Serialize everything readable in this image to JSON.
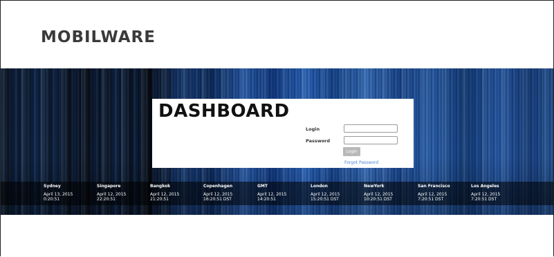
{
  "brand": {
    "logo_text": "MOBILWARE"
  },
  "dashboard": {
    "title": "DASHBOARD"
  },
  "login_form": {
    "login_label": "Login",
    "password_label": "Password",
    "login_value": "",
    "password_value": "",
    "submit_label": "Login",
    "forgot_link": "Forgot Password"
  },
  "clocks": [
    {
      "city": "Sydney",
      "date": "April 13, 2015",
      "time": "0:20:51"
    },
    {
      "city": "Singapore",
      "date": "April 12, 2015",
      "time": "22:20:51"
    },
    {
      "city": "Bangkok",
      "date": "April 12, 2015",
      "time": "21:20:51"
    },
    {
      "city": "Copenhagen",
      "date": "April 12, 2015",
      "time": "16:20:51 DST"
    },
    {
      "city": "GMT",
      "date": "April 12, 2015",
      "time": "14:20:51"
    },
    {
      "city": "London",
      "date": "April 12, 2015",
      "time": "15:20:51 DST"
    },
    {
      "city": "NewYork",
      "date": "April 12, 2015",
      "time": "10:20:51 DST"
    },
    {
      "city": "San Francisco",
      "date": "April 12, 2015",
      "time": "7:20:51 DST"
    },
    {
      "city": "Los Angeles",
      "date": "April 12, 2015",
      "time": "7:20:51 DST"
    }
  ],
  "colors": {
    "link": "#4a7fd0",
    "button": "#b8b8b8",
    "band_accent": "#2f6fcf"
  }
}
